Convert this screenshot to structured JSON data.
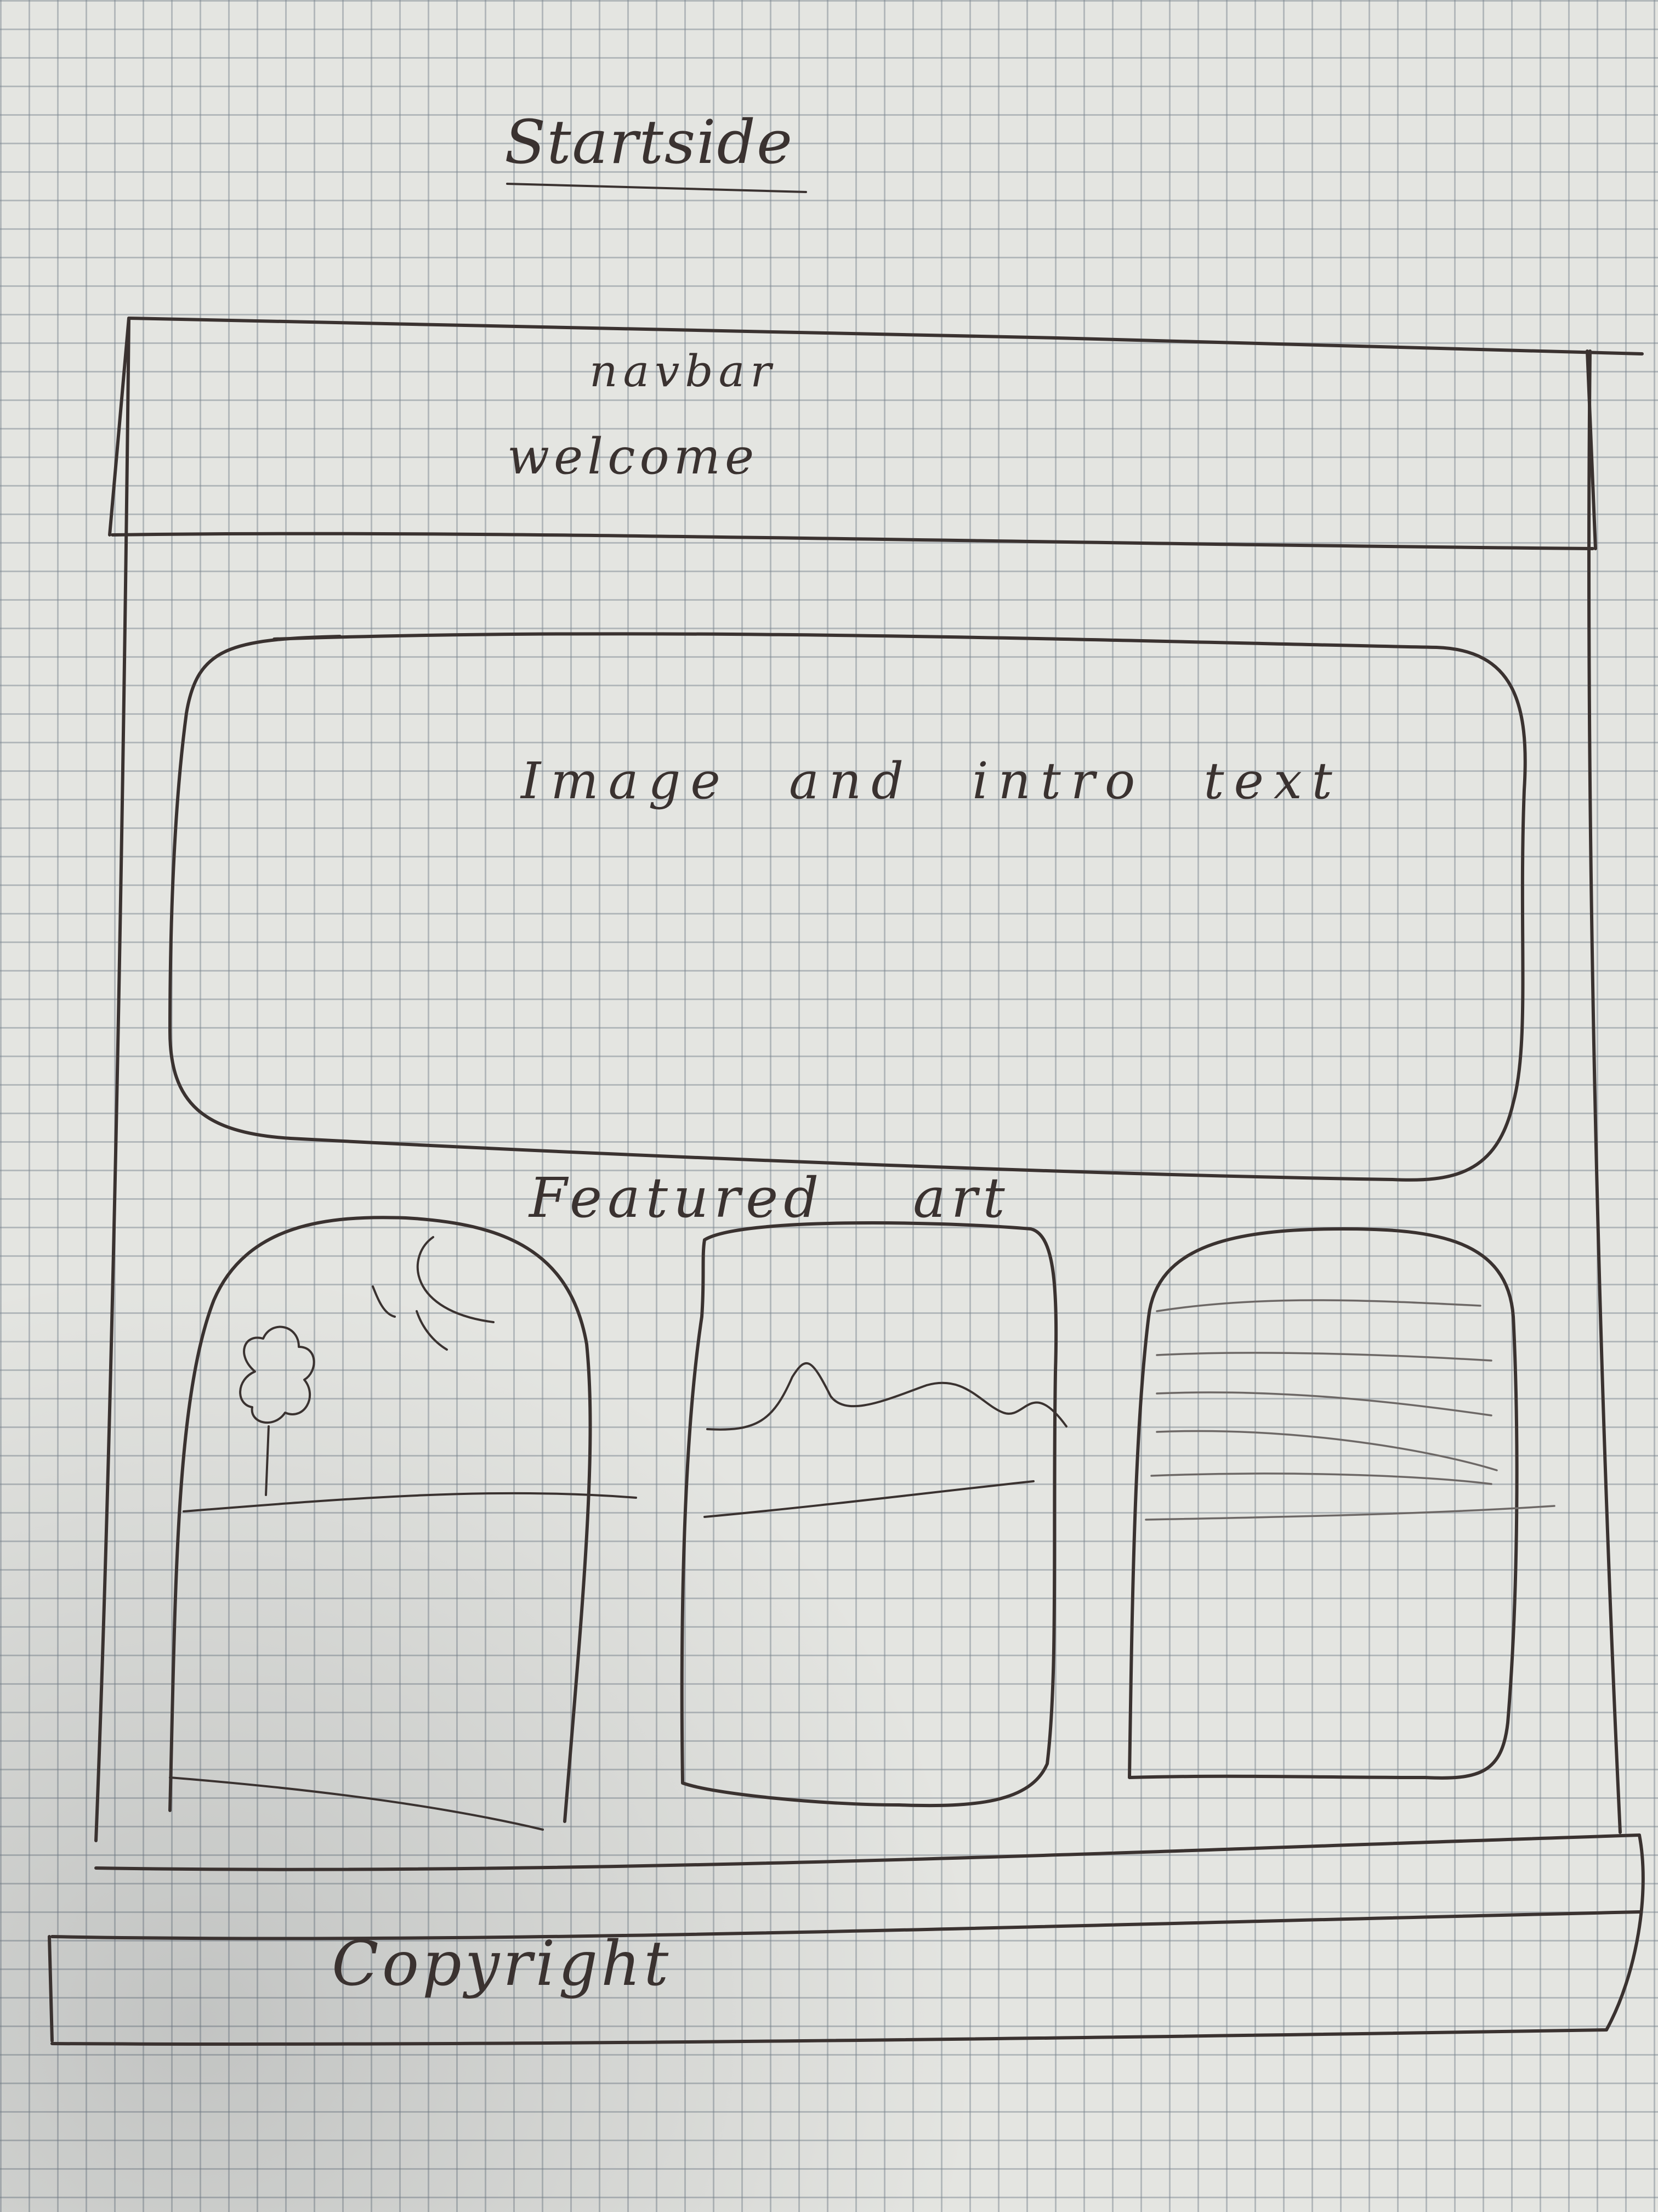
{
  "title": "Startside",
  "header": {
    "navbar_label": "navbar",
    "welcome_label": "welcome"
  },
  "hero": {
    "label": "Image and intro text"
  },
  "featured": {
    "label": "Featured art",
    "cards": [
      {
        "icon": "landscape-tree-moon-icon"
      },
      {
        "icon": "landscape-hills-icon"
      },
      {
        "icon": "landscape-lines-icon"
      }
    ]
  },
  "footer": {
    "label": "Copyright"
  }
}
